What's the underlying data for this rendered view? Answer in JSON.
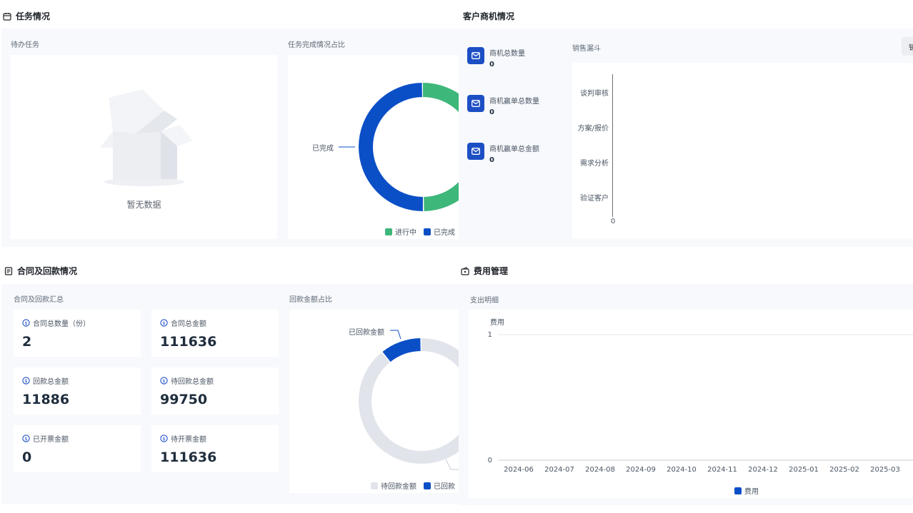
{
  "colors": {
    "primary_blue": "#0b4fc7",
    "green": "#3eb77a",
    "light_grey": "#e1e4ea",
    "panel_bg": "#f7f9fc"
  },
  "tasks": {
    "title": "任务情况",
    "icon": "calendar-icon",
    "todo": {
      "title": "待办任务",
      "empty_text": "暂无数据"
    },
    "completion": {
      "title": "任务完成情况占比",
      "label_done": "已完成",
      "legend": [
        "进行中",
        "已完成"
      ]
    }
  },
  "customer": {
    "title": "客户商机情况",
    "metrics": [
      {
        "label": "商机总数量",
        "value": "0"
      },
      {
        "label": "商机赢单总数量",
        "value": "0"
      },
      {
        "label": "商机赢单总金额",
        "value": "0"
      }
    ],
    "funnel": {
      "title": "销售漏斗",
      "stages": [
        "谈判审核",
        "方案/报价",
        "需求分析",
        "验证客户"
      ],
      "axis_zero": "0",
      "button_partial": "销"
    }
  },
  "contract": {
    "title": "合同及回款情况",
    "icon": "document-icon",
    "summary_title": "合同及回款汇总",
    "stats": [
      {
        "label": "合同总数量（份）",
        "value": "2"
      },
      {
        "label": "合同总金额",
        "value": "111636"
      },
      {
        "label": "回款总金额",
        "value": "11886"
      },
      {
        "label": "待回款总金额",
        "value": "99750"
      },
      {
        "label": "已开票金额",
        "value": "0"
      },
      {
        "label": "待开票金额",
        "value": "111636"
      }
    ],
    "ratio": {
      "title": "回款金额占比",
      "label_received": "已回款金额",
      "legend": [
        "待回款金额",
        "已回款金额"
      ],
      "legend_second_visible": "已回款"
    }
  },
  "expense": {
    "title": "费用管理",
    "icon": "wallet-icon",
    "detail_title": "支出明细",
    "y_axis_title": "费用",
    "legend": "费用"
  },
  "chart_data": [
    {
      "type": "pie",
      "title": "任务完成情况占比",
      "categories": [
        "进行中",
        "已完成"
      ],
      "values": [
        1,
        1
      ],
      "colors": [
        "#3eb77a",
        "#0b4fc7"
      ],
      "donut": true
    },
    {
      "type": "pie",
      "title": "回款金额占比",
      "categories": [
        "待回款金额",
        "已回款金额"
      ],
      "values": [
        99750,
        11886
      ],
      "colors": [
        "#e1e4ea",
        "#0b4fc7"
      ],
      "donut": true
    },
    {
      "type": "bar",
      "title": "销售漏斗",
      "categories": [
        "谈判审核",
        "方案/报价",
        "需求分析",
        "验证客户"
      ],
      "values": [
        0,
        0,
        0,
        0
      ],
      "orientation": "horizontal"
    },
    {
      "type": "bar",
      "title": "支出明细",
      "ylabel": "费用",
      "x": [
        "2024-06",
        "2024-07",
        "2024-08",
        "2024-09",
        "2024-10",
        "2024-11",
        "2024-12",
        "2025-01",
        "2025-02",
        "2025-03"
      ],
      "series": [
        {
          "name": "费用",
          "values": [
            0,
            0,
            0,
            0,
            0,
            0,
            0,
            0,
            0,
            0
          ]
        }
      ],
      "yticks": [
        "1",
        "0"
      ],
      "ylim": [
        0,
        1
      ]
    }
  ]
}
